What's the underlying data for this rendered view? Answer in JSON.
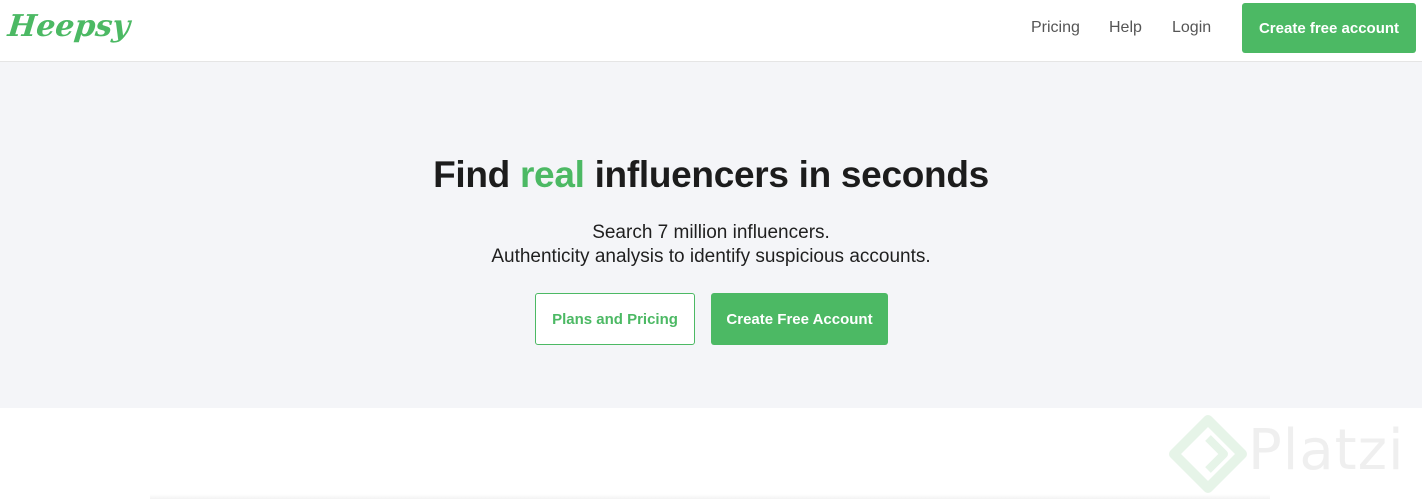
{
  "header": {
    "logo": "Heepsy",
    "nav": {
      "pricing": "Pricing",
      "help": "Help",
      "login": "Login"
    },
    "cta": "Create free account"
  },
  "hero": {
    "title_before": "Find ",
    "title_accent": "real",
    "title_after": " influencers in seconds",
    "subtitle_line1": "Search 7 million influencers.",
    "subtitle_line2": "Authenticity analysis to identify suspicious accounts.",
    "button_plans": "Plans and Pricing",
    "button_create": "Create Free Account"
  },
  "watermark": {
    "text": "Platzi",
    "icon": "platzi-logo-icon"
  },
  "colors": {
    "brand_green": "#4cb964",
    "hero_background": "#f4f5f8",
    "text_dark": "#1c1c1c",
    "nav_text": "#555555"
  }
}
